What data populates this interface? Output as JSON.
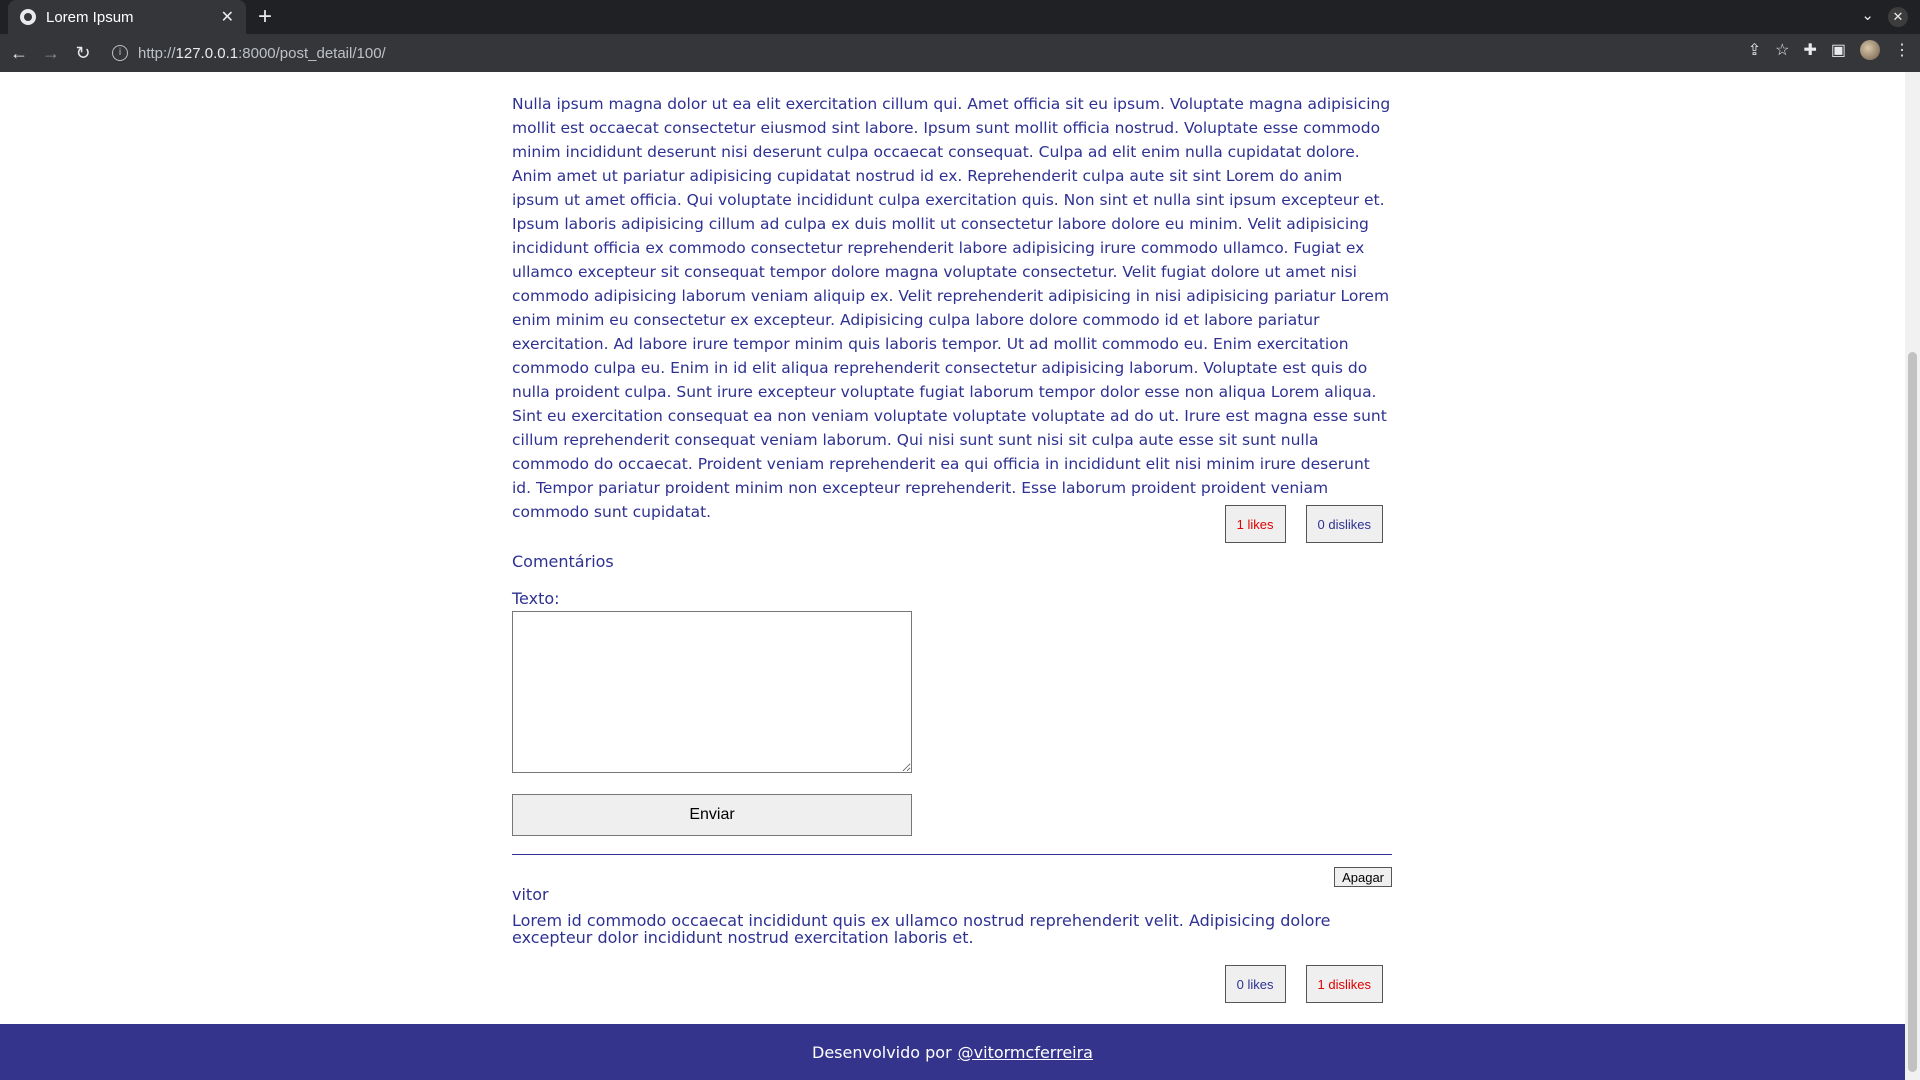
{
  "browser": {
    "tab_title": "Lorem Ipsum",
    "url_prefix": "http://",
    "url_host": "127.0.0.1",
    "url_rest": ":8000/post_detail/100/"
  },
  "post": {
    "body": "Nulla ipsum magna dolor ut ea elit exercitation cillum qui. Amet officia sit eu ipsum. Voluptate magna adipisicing mollit est occaecat consectetur eiusmod sint labore. Ipsum sunt mollit officia nostrud. Voluptate esse commodo minim incididunt deserunt nisi deserunt culpa occaecat consequat. Culpa ad elit enim nulla cupidatat dolore. Anim amet ut pariatur adipisicing cupidatat nostrud id ex. Reprehenderit culpa aute sit sint Lorem do anim ipsum ut amet officia. Qui voluptate incididunt culpa exercitation quis. Non sint et nulla sint ipsum excepteur et. Ipsum laboris adipisicing cillum ad culpa ex duis mollit ut consectetur labore dolore eu minim. Velit adipisicing incididunt officia ex commodo consectetur reprehenderit labore adipisicing irure commodo ullamco. Fugiat ex ullamco excepteur sit consequat tempor dolore magna voluptate consectetur. Velit fugiat dolore ut amet nisi commodo adipisicing laborum veniam aliquip ex. Velit reprehenderit adipisicing in nisi adipisicing pariatur Lorem enim minim eu consectetur ex excepteur. Adipisicing culpa labore dolore commodo id et labore pariatur exercitation. Ad labore irure tempor minim quis laboris tempor. Ut ad mollit commodo eu. Enim exercitation commodo culpa eu. Enim in id elit aliqua reprehenderit consectetur adipisicing laborum. Voluptate est quis do nulla proident culpa. Sunt irure excepteur voluptate fugiat laborum tempor dolor esse non aliqua Lorem aliqua. Sint eu exercitation consequat ea non veniam voluptate voluptate voluptate ad do ut. Irure est magna esse sunt cillum reprehenderit consequat veniam laborum. Qui nisi sunt sunt nisi sit culpa aute esse sit sunt nulla commodo do occaecat. Proident veniam reprehenderit ea qui officia in incididunt elit nisi minim irure deserunt id. Tempor pariatur proident minim non excepteur reprehenderit. Esse laborum proident proident veniam commodo sunt cupidatat.",
    "likes_label": "1 likes",
    "dislikes_label": "0 dislikes"
  },
  "comments_section": {
    "title": "Comentários",
    "texto_label": "Texto:",
    "send_label": "Enviar"
  },
  "comment": {
    "delete_label": "Apagar",
    "author": "vitor",
    "text": "Lorem id commodo occaecat incididunt quis ex ullamco nostrud reprehenderit velit. Adipisicing dolore excepteur dolor incididunt nostrud exercitation laboris et.",
    "likes_label": "0 likes",
    "dislikes_label": "1 dislikes"
  },
  "footer": {
    "prefix": "Desenvolvido por",
    "link": "@vitormcferreira"
  },
  "colors": {
    "text": "#2e3192",
    "footer_bg": "#34348c",
    "active_vote": "#e00000"
  }
}
